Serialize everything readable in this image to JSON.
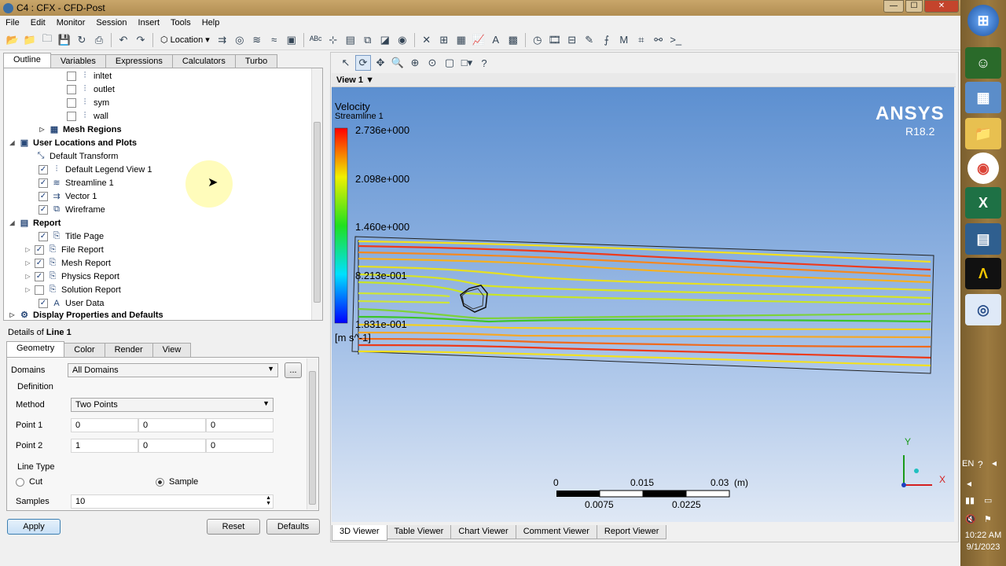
{
  "window": {
    "title": "C4 : CFX - CFD-Post",
    "buttons": [
      "—",
      "☐",
      "✕"
    ]
  },
  "menu": [
    "File",
    "Edit",
    "Monitor",
    "Session",
    "Insert",
    "Tools",
    "Help"
  ],
  "toolbar": {
    "location_label": "Location"
  },
  "outline_tabs": [
    "Outline",
    "Variables",
    "Expressions",
    "Calculators",
    "Turbo"
  ],
  "tree": {
    "items": [
      {
        "label": "inltet",
        "checked": false
      },
      {
        "label": "outlet",
        "checked": false
      },
      {
        "label": "sym",
        "checked": false
      },
      {
        "label": "wall",
        "checked": false
      },
      {
        "label": "Mesh Regions"
      },
      {
        "label": "User Locations and Plots"
      },
      {
        "label": "Default Transform"
      },
      {
        "label": "Default Legend View 1",
        "checked": true
      },
      {
        "label": "Streamline 1",
        "checked": true
      },
      {
        "label": "Vector 1",
        "checked": true
      },
      {
        "label": "Wireframe",
        "checked": true
      },
      {
        "label": "Report"
      },
      {
        "label": "Title Page",
        "checked": true
      },
      {
        "label": "File Report",
        "checked": true
      },
      {
        "label": "Mesh Report",
        "checked": true
      },
      {
        "label": "Physics Report",
        "checked": true
      },
      {
        "label": "Solution Report",
        "checked": false
      },
      {
        "label": "User Data",
        "checked": true
      },
      {
        "label": "Display Properties and Defaults"
      }
    ]
  },
  "details": {
    "prefix": "Details of ",
    "object": "Line 1",
    "tabs": [
      "Geometry",
      "Color",
      "Render",
      "View"
    ],
    "domains_label": "Domains",
    "domains_value": "All Domains",
    "more_btn": "...",
    "definition_label": "Definition",
    "method_label": "Method",
    "method_value": "Two Points",
    "point1_label": "Point 1",
    "point1": [
      "0",
      "0",
      "0"
    ],
    "point2_label": "Point 2",
    "point2": [
      "1",
      "0",
      "0"
    ],
    "linetype_label": "Line Type",
    "cut_label": "Cut",
    "sample_label": "Sample",
    "selected_type": "Sample",
    "samples_label": "Samples",
    "samples_value": "10",
    "apply": "Apply",
    "reset": "Reset",
    "defaults": "Defaults"
  },
  "viewer": {
    "view_name": "View 1",
    "legend_title": "Velocity",
    "legend_sub": "Streamline 1",
    "legend_values": [
      "2.736e+000",
      "2.098e+000",
      "1.460e+000",
      "8.213e-001",
      "1.831e-001"
    ],
    "legend_unit": "[m s^-1]",
    "brand": "ANSYS",
    "version": "R18.2",
    "scale_top": [
      "0",
      "0.015",
      "0.03",
      "(m)"
    ],
    "scale_bottom": [
      "0.0075",
      "0.0225"
    ],
    "axis_y": "Y",
    "axis_x": "X",
    "tabs": [
      "3D Viewer",
      "Table Viewer",
      "Chart Viewer",
      "Comment Viewer",
      "Report Viewer"
    ]
  },
  "taskbar": {
    "lang": "EN",
    "time": "10:22 AM",
    "date": "9/1/2023"
  }
}
